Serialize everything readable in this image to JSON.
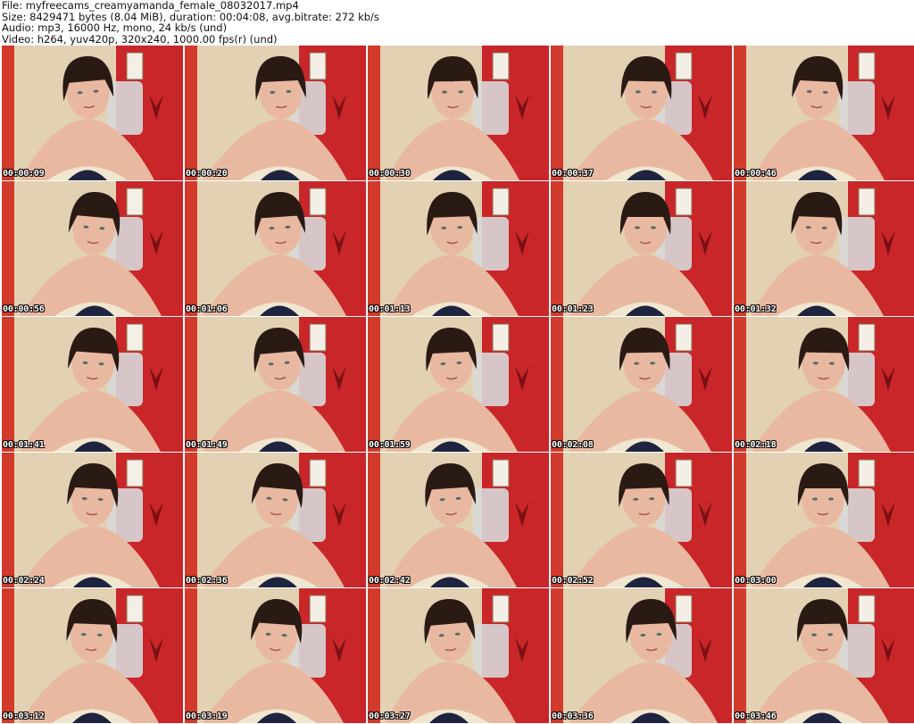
{
  "header": {
    "file_line": "File: myfreecams_creamyamanda_female_08032017.mp4",
    "size_line": "Size: 8429471 bytes (8.04 MiB), duration: 00:04:08, avg.bitrate: 272 kb/s",
    "audio_line": "Audio: mp3, 16000 Hz, mono, 24 kb/s (und)",
    "video_line": "Video: h264, yuv420p, 320x240, 1000.00 fps(r) (und)"
  },
  "thumbnails": [
    {
      "timestamp": "00:00:09"
    },
    {
      "timestamp": "00:00:20"
    },
    {
      "timestamp": "00:00:30"
    },
    {
      "timestamp": "00:00:37"
    },
    {
      "timestamp": "00:00:46"
    },
    {
      "timestamp": "00:00:56"
    },
    {
      "timestamp": "00:01:06"
    },
    {
      "timestamp": "00:01:13"
    },
    {
      "timestamp": "00:01:23"
    },
    {
      "timestamp": "00:01:32"
    },
    {
      "timestamp": "00:01:41"
    },
    {
      "timestamp": "00:01:49"
    },
    {
      "timestamp": "00:01:59"
    },
    {
      "timestamp": "00:02:08"
    },
    {
      "timestamp": "00:02:18"
    },
    {
      "timestamp": "00:02:24"
    },
    {
      "timestamp": "00:02:36"
    },
    {
      "timestamp": "00:02:42"
    },
    {
      "timestamp": "00:02:52"
    },
    {
      "timestamp": "00:03:00"
    },
    {
      "timestamp": "00:03:12"
    },
    {
      "timestamp": "00:03:19"
    },
    {
      "timestamp": "00:03:27"
    },
    {
      "timestamp": "00:03:36"
    },
    {
      "timestamp": "00:03:46"
    }
  ],
  "colors": {
    "wall": "#c9262a",
    "curtain": "#e3d1b3",
    "hair": "#2a1a14",
    "skin": "#e8b9a0",
    "top": "#f1e6cf",
    "bra": "#1e2440"
  }
}
